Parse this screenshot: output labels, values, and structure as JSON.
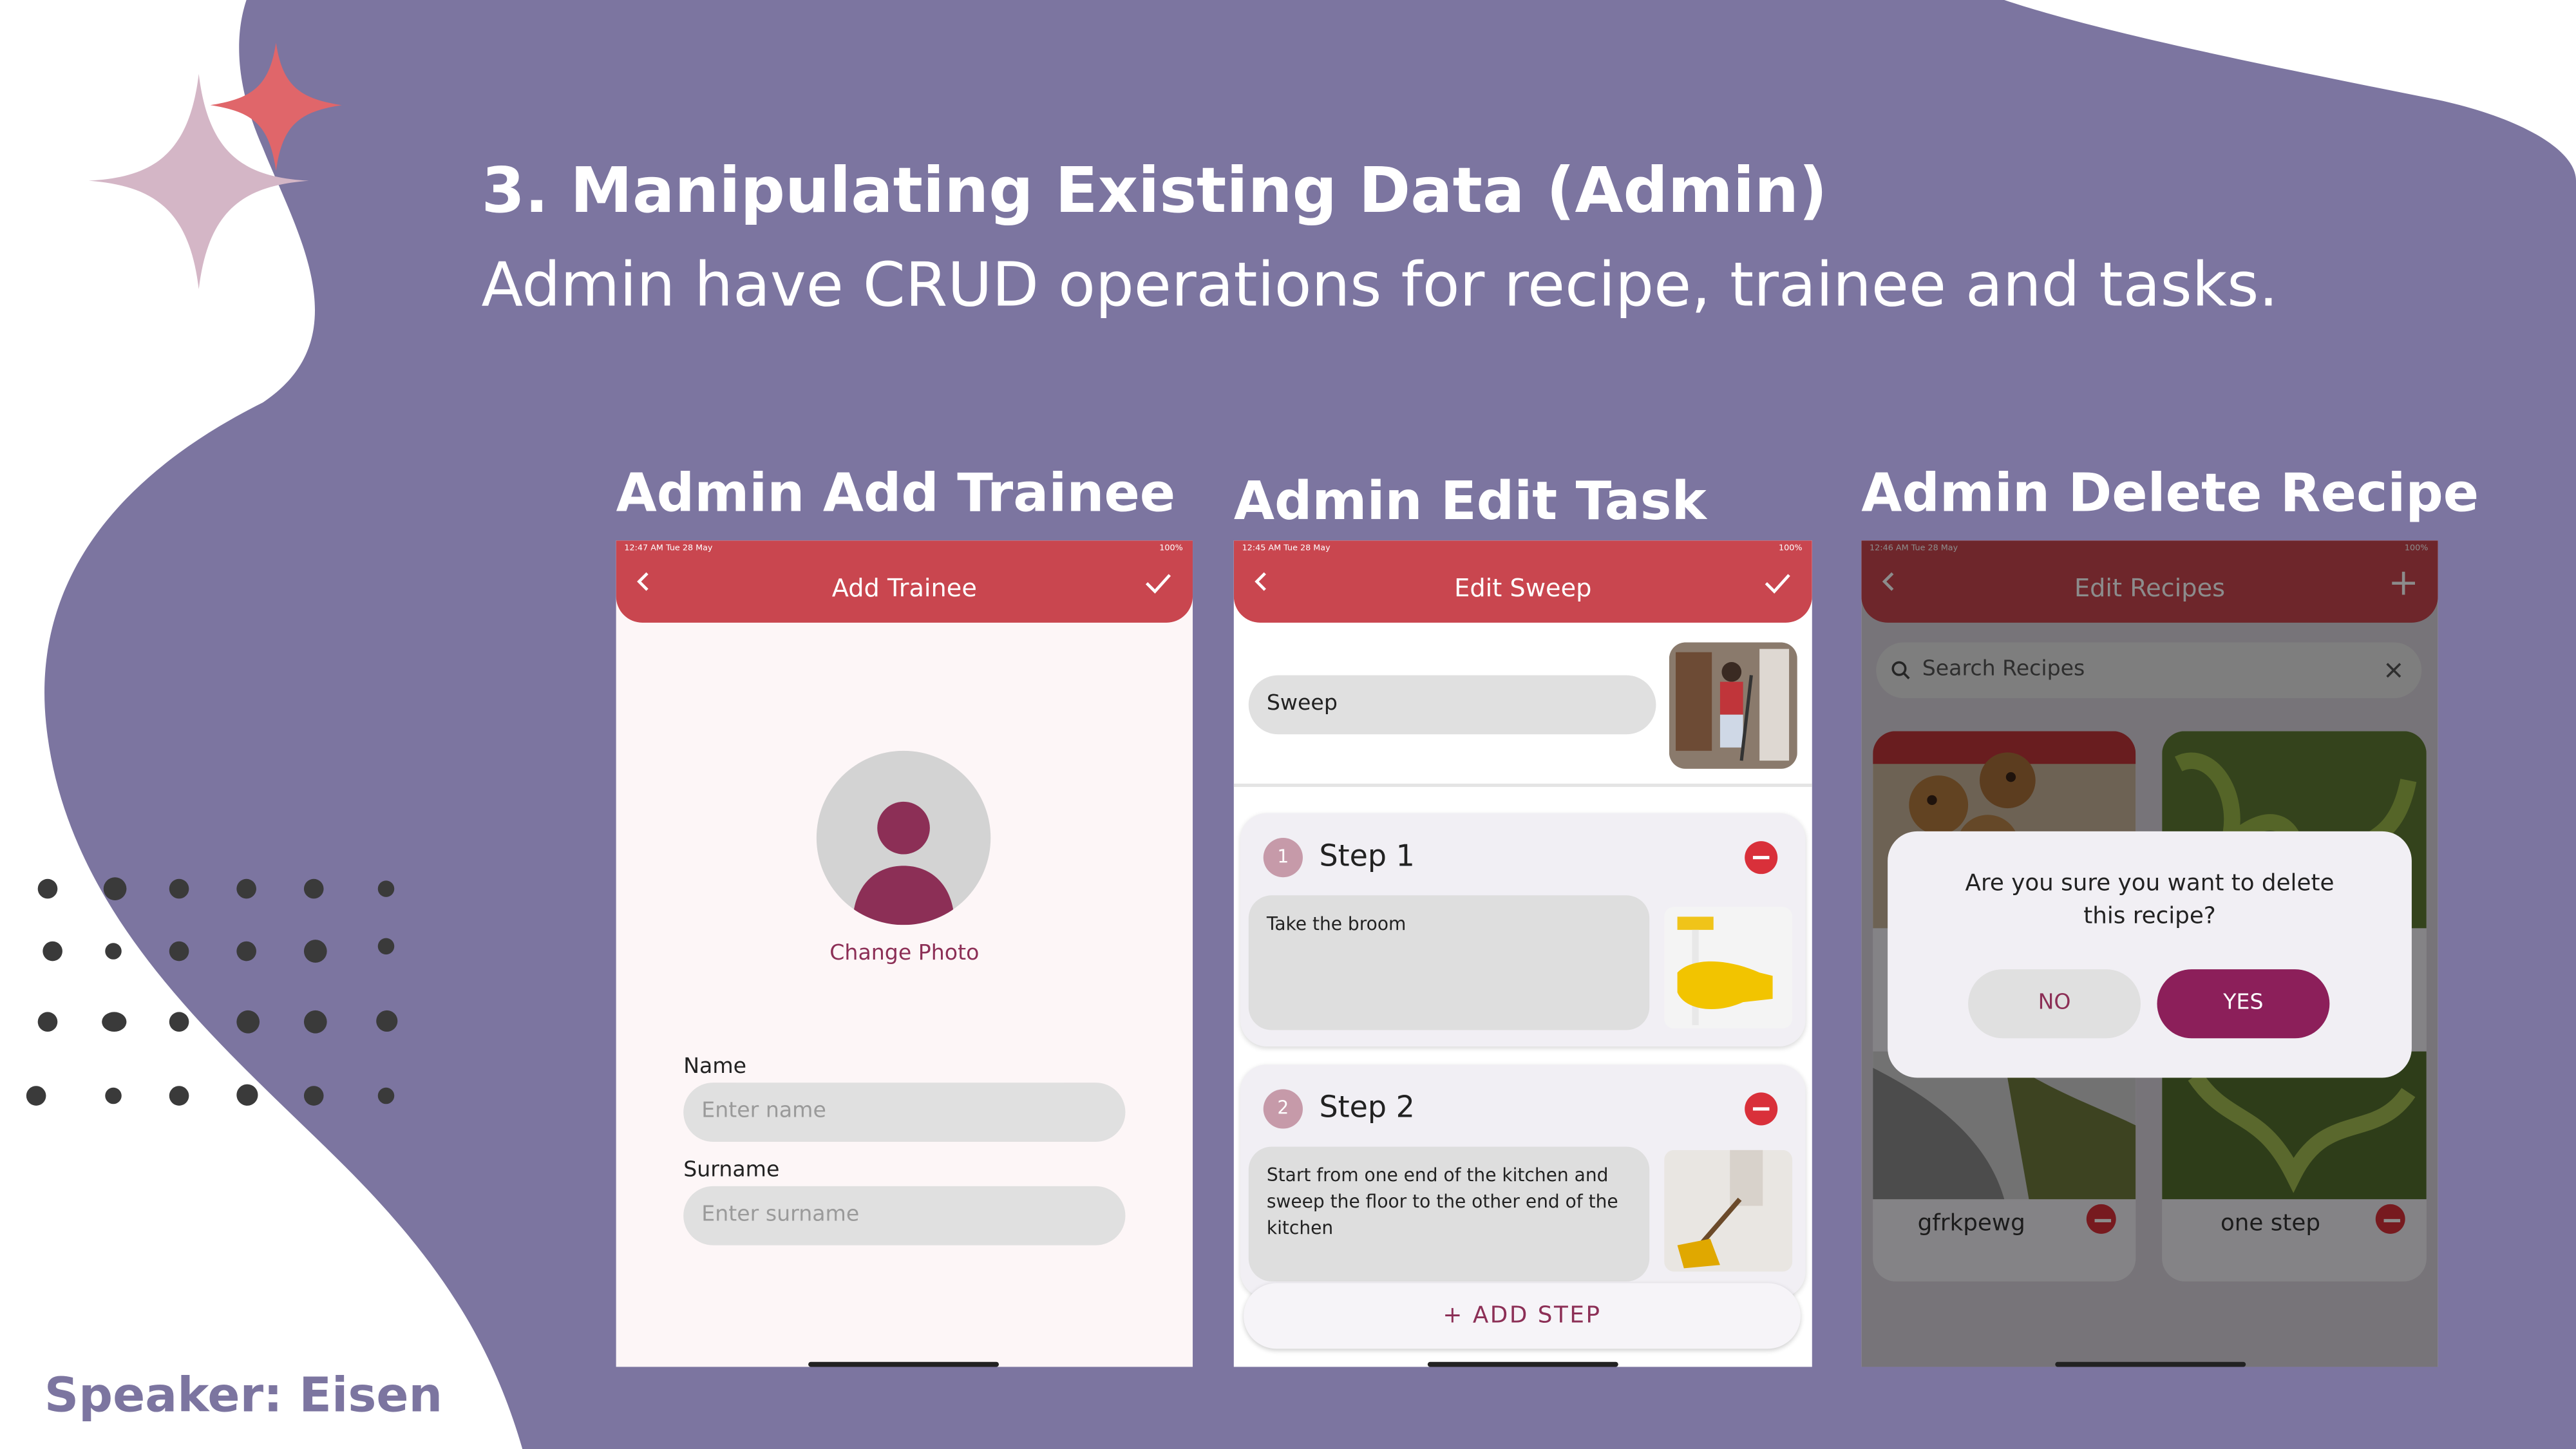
{
  "slide": {
    "title": "3. Manipulating Existing Data (Admin)",
    "subtitle": "Admin have CRUD operations for recipe, trainee and tasks.",
    "speaker": "Speaker: Eisen",
    "colors": {
      "background": "#7c75a0",
      "accent": "#c9464f",
      "sparkle_red": "#e0666a",
      "sparkle_pink": "#d4b6c6"
    }
  },
  "sections": {
    "add_trainee": "Admin Add Trainee",
    "edit_task": "Admin Edit Task",
    "delete_recipe": "Admin Delete Recipe"
  },
  "phone1": {
    "status_time": "12:47 AM   Tue 28 May",
    "status_right": "100%",
    "title": "Add Trainee",
    "change_photo": "Change Photo",
    "name_label": "Name",
    "name_placeholder": "Enter name",
    "surname_label": "Surname",
    "surname_placeholder": "Enter surname"
  },
  "phone2": {
    "status_time": "12:45 AM   Tue 28 May",
    "status_right": "100%",
    "title": "Edit Sweep",
    "task_name": "Sweep",
    "steps": [
      {
        "num": "1",
        "title": "Step 1",
        "text": "Take the broom"
      },
      {
        "num": "2",
        "title": "Step 2",
        "text": "Start from one end of the kitchen and sweep the floor to the other end of the kitchen"
      }
    ],
    "add_step": "+ ADD STEP"
  },
  "phone3": {
    "status_time": "12:46 AM   Tue 28 May",
    "status_right": "100%",
    "title": "Edit Recipes",
    "search_placeholder": "Search Recipes",
    "recipes": [
      "gfrkpewg",
      "one step"
    ],
    "dialog": {
      "message": "Are you sure you want to delete this recipe?",
      "no": "NO",
      "yes": "YES"
    }
  }
}
